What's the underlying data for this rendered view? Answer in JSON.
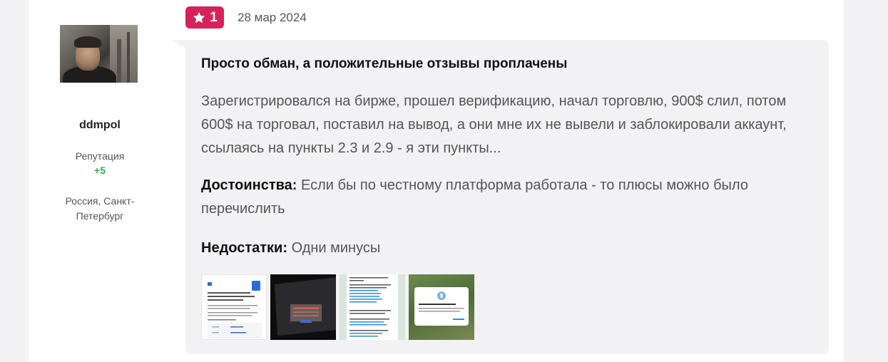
{
  "author": {
    "username": "ddmpol",
    "reputation_label": "Репутация",
    "reputation_value": "+5",
    "location": "Россия, Санкт-Петербург"
  },
  "review": {
    "rating": "1",
    "date": "28 мар 2024",
    "title": "Просто обман, а положительные отзывы проплачены",
    "text": "Зарегистрировался на бирже, прошел верификацию, начал торговлю, 900$ слил, потом 600$ на торговал, поставил на вывод, а они мне их не вывели и заблокировали аккаунт, ссылаясь на пункты 2.3 и 2.9 - я эти пункты...",
    "pros_label": "Достоинства:",
    "pros_text": "Если бы по честному платформа работала - то плюсы можно было перечислить",
    "cons_label": "Недостатки:",
    "cons_text": "Одни минусы"
  },
  "colors": {
    "rating_badge": "#d6225a",
    "reputation_positive": "#2bb24c"
  }
}
